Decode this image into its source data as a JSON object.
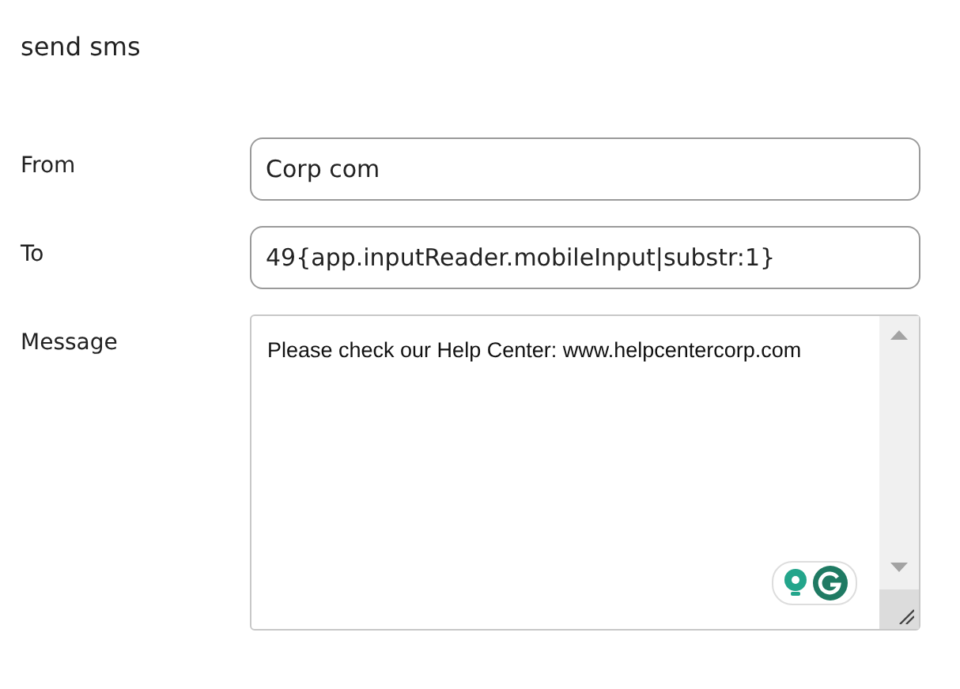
{
  "title": "send sms",
  "fields": [
    {
      "label": "From",
      "value": "Corp com",
      "kind": "input"
    },
    {
      "label": "To",
      "value": "49{app.inputReader.mobileInput|substr:1}",
      "kind": "input"
    },
    {
      "label": "Message",
      "value": "Please check our Help Center: www.helpcentercorp.com",
      "kind": "textarea"
    }
  ]
}
